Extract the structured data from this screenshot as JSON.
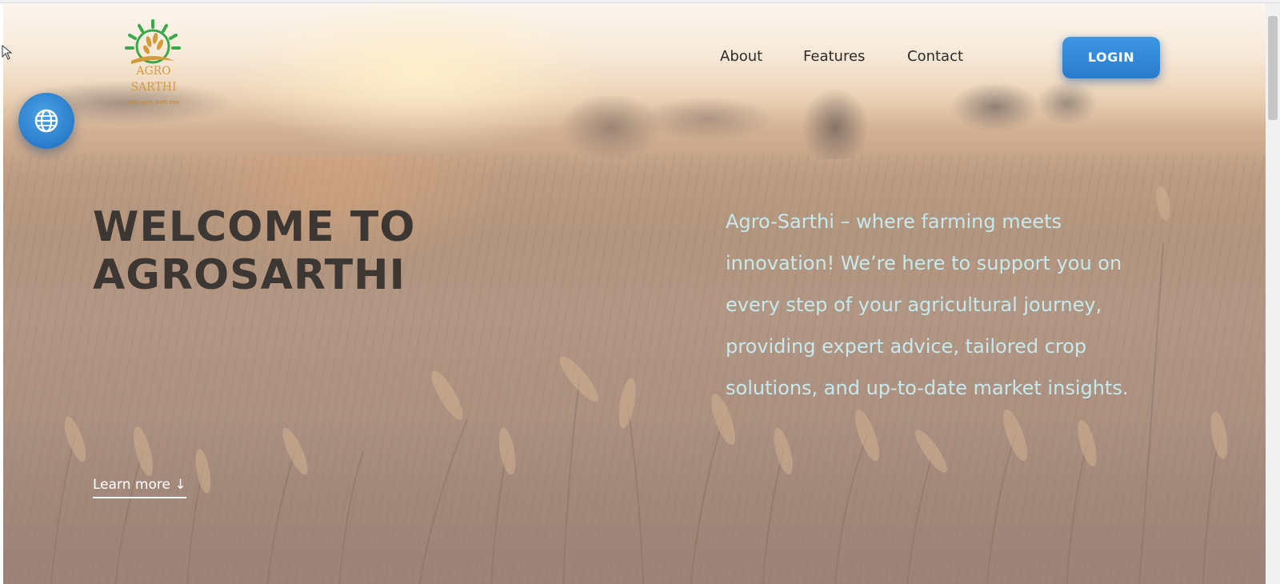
{
  "logo": {
    "name_line1": "AGRO",
    "name_line2": "SARTHI",
    "tagline": "सबका सुझाव, सबकी सलाह"
  },
  "nav": {
    "links": [
      "About",
      "Features",
      "Contact"
    ],
    "login_label": "LOGIN"
  },
  "hero": {
    "headline_line1": "WELCOME TO",
    "headline_line2": "AGROSARTHI",
    "description": "Agro-Sarthi – where farming meets innovation! We’re here to support you on every step of your agricultural journey, providing expert advice, tailored crop solutions, and up-to-date market insights.",
    "learn_more": "Learn more ↓"
  },
  "icons": {
    "language": "globe-icon",
    "logo": "wheat-sun-icon"
  },
  "colors": {
    "accent_blue": "#2a7bcd",
    "headline": "#3d3734",
    "description_text": "#c6e9ee",
    "logo_gold": "#d49a3b"
  }
}
